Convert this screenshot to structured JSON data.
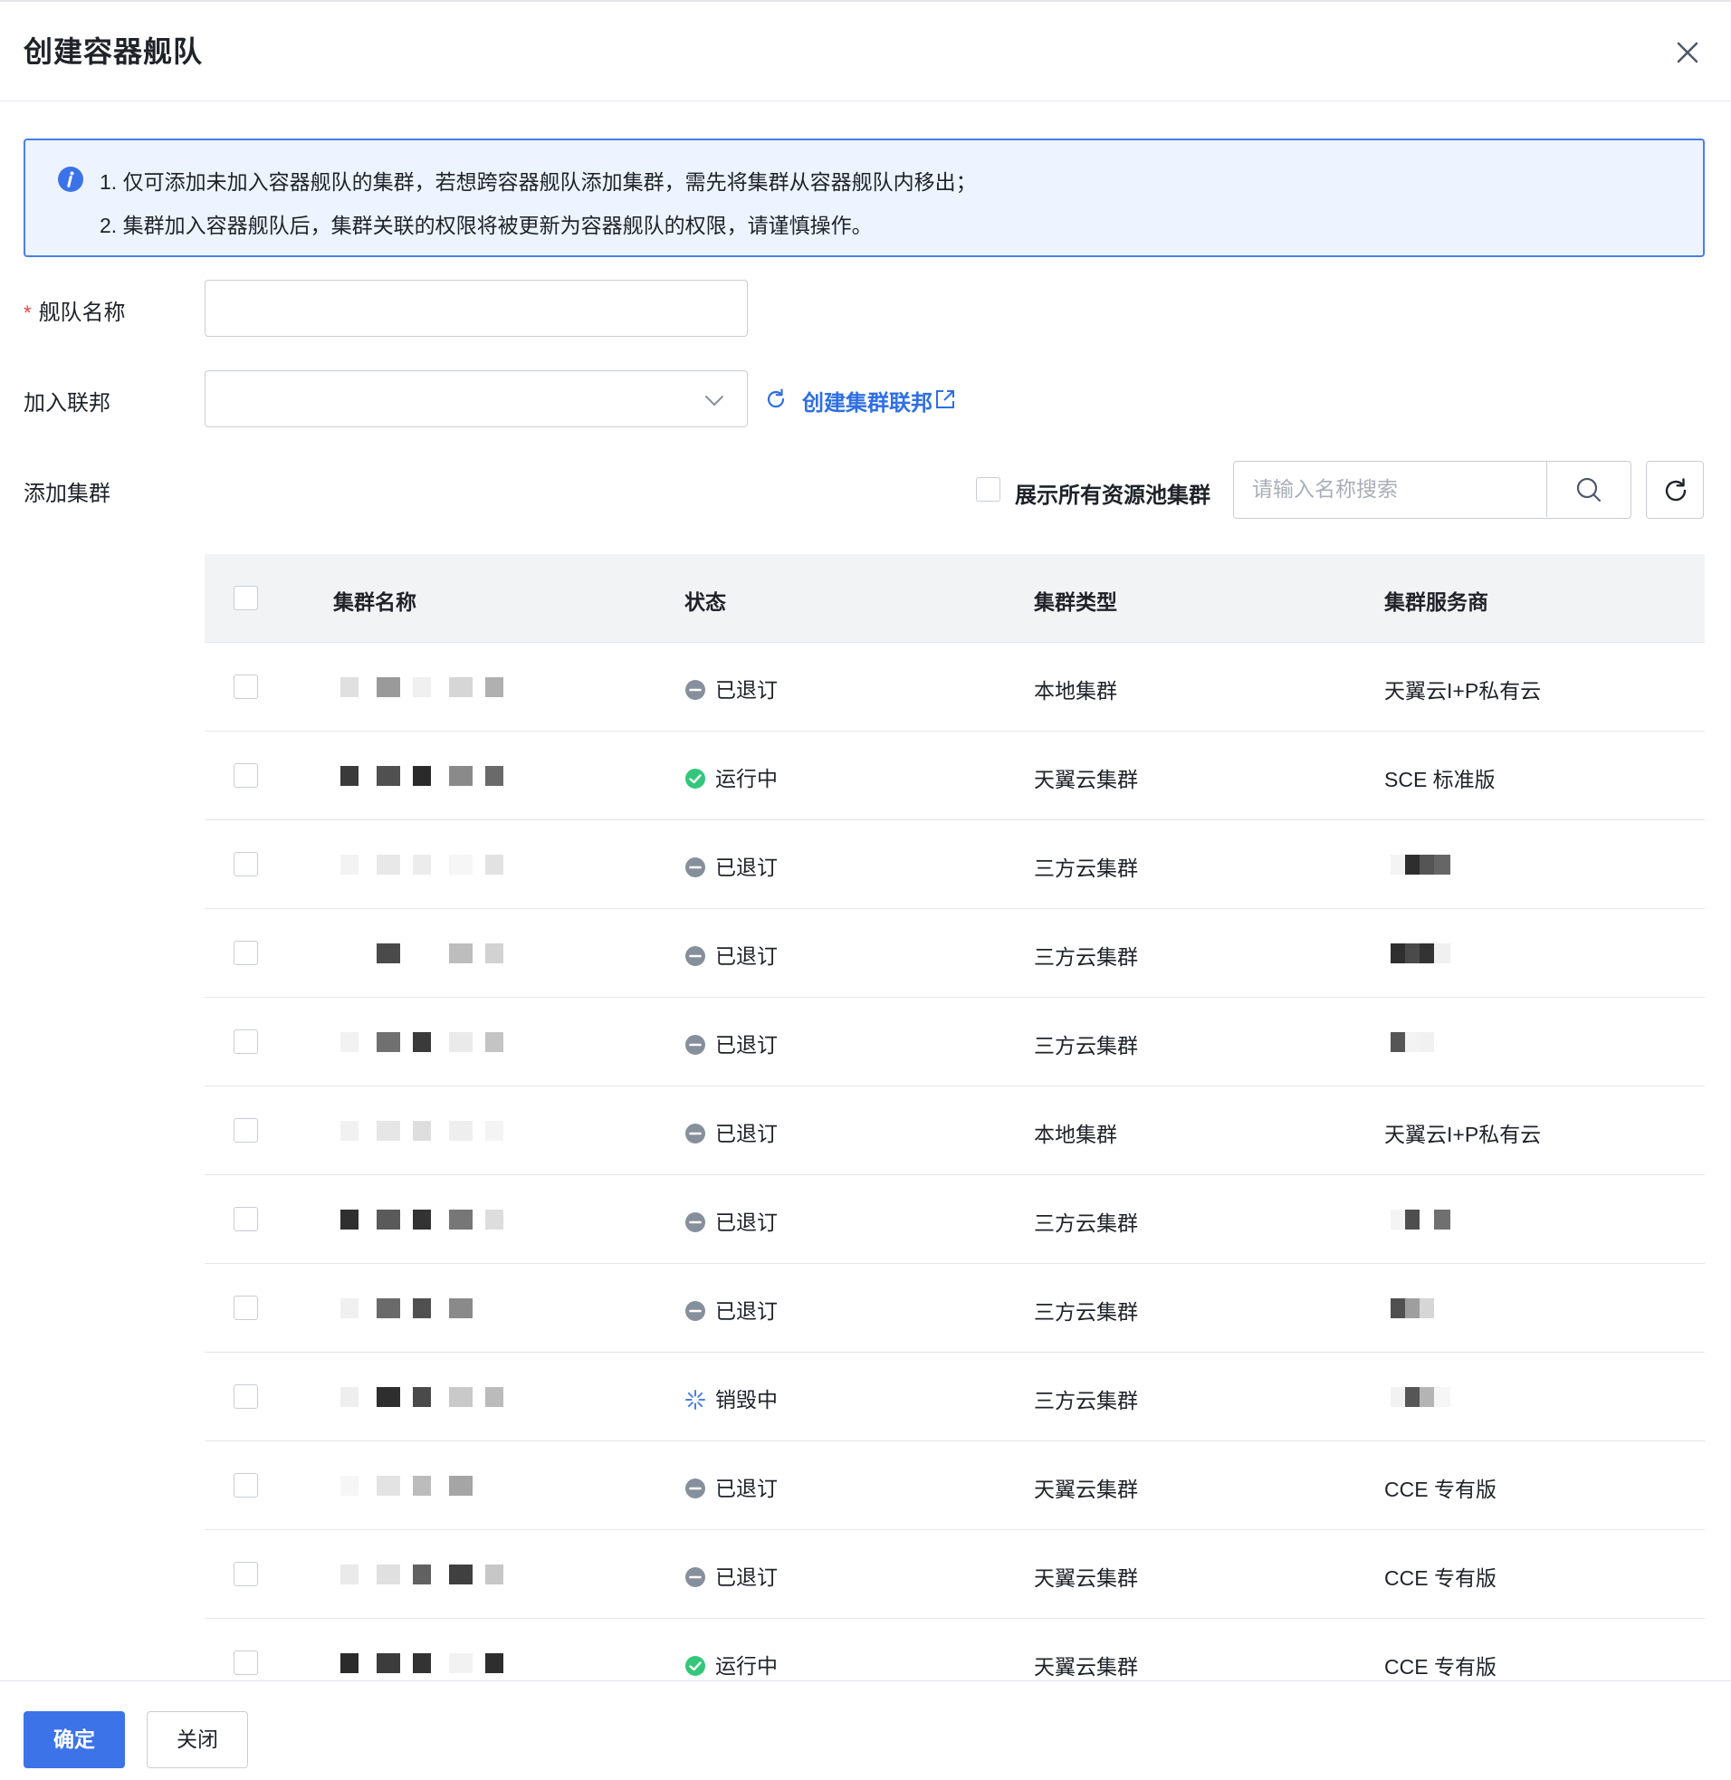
{
  "dialog": {
    "title": "创建容器舰队",
    "close_icon": "close-icon"
  },
  "alert": {
    "icon": "info-icon",
    "line1": "1. 仅可添加未加入容器舰队的集群，若想跨容器舰队添加集群，需先将集群从容器舰队内移出；",
    "line2": "2. 集群加入容器舰队后，集群关联的权限将被更新为容器舰队的权限，请谨慎操作。",
    "accent_color": "#4a7fea",
    "background_color": "#eef4ff"
  },
  "form": {
    "fleet_name_label": "舰队名称",
    "fleet_name_required": "*",
    "fleet_name_value": "",
    "federation_label": "加入联邦",
    "federation_value": "",
    "create_federation_link": "创建集群联邦",
    "add_cluster_label": "添加集群",
    "show_all_pools_label": "展示所有资源池集群",
    "search_placeholder": "请输入名称搜索"
  },
  "table": {
    "columns": [
      "集群名称",
      "状态",
      "集群类型",
      "集群服务商"
    ],
    "rows": [
      {
        "status": "已退订",
        "status_type": "stopped",
        "type": "本地集群",
        "provider": "天翼云I+P私有云",
        "provider_redacted": false
      },
      {
        "status": "运行中",
        "status_type": "running",
        "type": "天翼云集群",
        "provider": "SCE 标准版",
        "provider_redacted": false
      },
      {
        "status": "已退订",
        "status_type": "stopped",
        "type": "三方云集群",
        "provider": "",
        "provider_redacted": true
      },
      {
        "status": "已退订",
        "status_type": "stopped",
        "type": "三方云集群",
        "provider": "",
        "provider_redacted": true
      },
      {
        "status": "已退订",
        "status_type": "stopped",
        "type": "三方云集群",
        "provider": "",
        "provider_redacted": true
      },
      {
        "status": "已退订",
        "status_type": "stopped",
        "type": "本地集群",
        "provider": "天翼云I+P私有云",
        "provider_redacted": false
      },
      {
        "status": "已退订",
        "status_type": "stopped",
        "type": "三方云集群",
        "provider": "",
        "provider_redacted": true
      },
      {
        "status": "已退订",
        "status_type": "stopped",
        "type": "三方云集群",
        "provider": "",
        "provider_redacted": true
      },
      {
        "status": "销毁中",
        "status_type": "destroying",
        "type": "三方云集群",
        "provider": "",
        "provider_redacted": true
      },
      {
        "status": "已退订",
        "status_type": "stopped",
        "type": "天翼云集群",
        "provider": "CCE 专有版",
        "provider_redacted": false
      },
      {
        "status": "已退订",
        "status_type": "stopped",
        "type": "天翼云集群",
        "provider": "CCE 专有版",
        "provider_redacted": false
      },
      {
        "status": "运行中",
        "status_type": "running",
        "type": "天翼云集群",
        "provider": "CCE 专有版",
        "provider_redacted": false
      }
    ]
  },
  "footer": {
    "confirm_label": "确定",
    "close_label": "关闭"
  },
  "colors": {
    "primary": "#3c73e8",
    "link": "#2f6fe4",
    "running": "#34c77b",
    "stopped": "#86909c",
    "destroying": "#4a7fea",
    "required": "#f53f3f"
  }
}
